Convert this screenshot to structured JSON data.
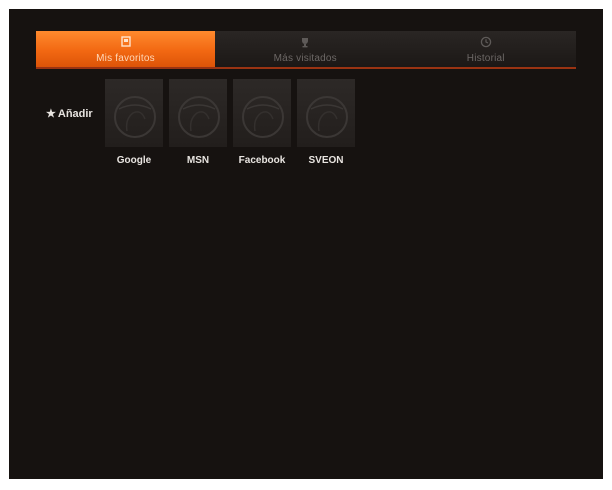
{
  "tabs": [
    {
      "label": "Mis favoritos",
      "icon": "bookmark-icon",
      "active": true
    },
    {
      "label": "Más visitados",
      "icon": "trophy-icon",
      "active": false
    },
    {
      "label": "Historial",
      "icon": "clock-icon",
      "active": false
    }
  ],
  "add_label": "Añadir",
  "add_icon": "star-icon",
  "bookmarks": [
    {
      "label": "Google",
      "icon": "globe-icon"
    },
    {
      "label": "MSN",
      "icon": "globe-icon"
    },
    {
      "label": "Facebook",
      "icon": "globe-icon"
    },
    {
      "label": "SVEON",
      "icon": "globe-icon"
    }
  ],
  "colors": {
    "accent": "#f26812",
    "background": "#161210",
    "tab_bar": "#221e1c",
    "text": "#e9e5e1"
  }
}
